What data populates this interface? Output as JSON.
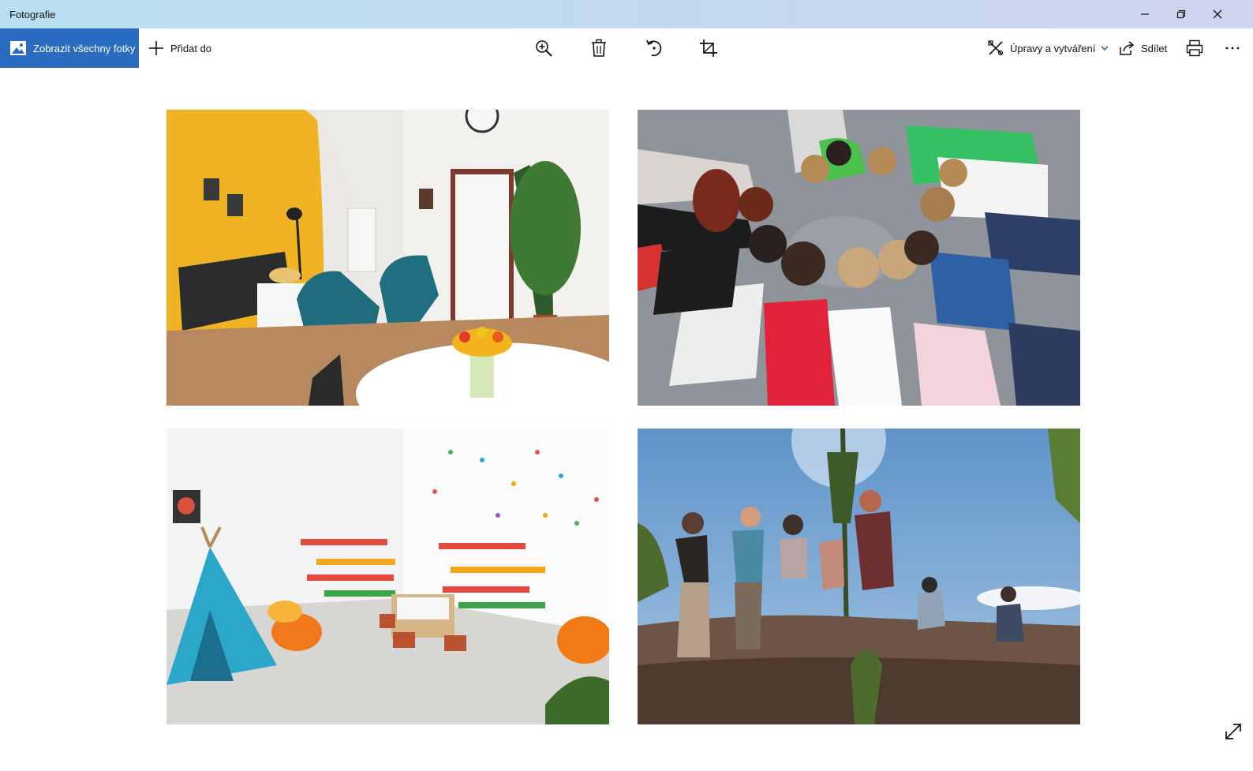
{
  "window": {
    "title": "Fotografie",
    "controls": [
      "minimize-icon",
      "restore-icon",
      "close-icon"
    ]
  },
  "toolbar": {
    "view_all_label": "Zobrazit všechny fotky",
    "add_to_label": "Přidat do",
    "zoom_icon": "zoom-in-icon",
    "delete_icon": "trash-icon",
    "rotate_icon": "rotate-icon",
    "crop_icon": "crop-icon",
    "edit_create_label": "Úpravy a vytváření",
    "share_label": "Sdílet",
    "print_icon": "print-icon",
    "more_icon": "more-icon"
  },
  "colors": {
    "accent": "#2a6cbf",
    "titlebar_left": "#b9dff2",
    "titlebar_right": "#cfd4f0"
  },
  "photos": [
    {
      "name": "photo-living-room"
    },
    {
      "name": "photo-children-circle"
    },
    {
      "name": "photo-playroom"
    },
    {
      "name": "photo-hike-rocks"
    }
  ],
  "footer": {
    "expand_icon": "expand-icon"
  }
}
